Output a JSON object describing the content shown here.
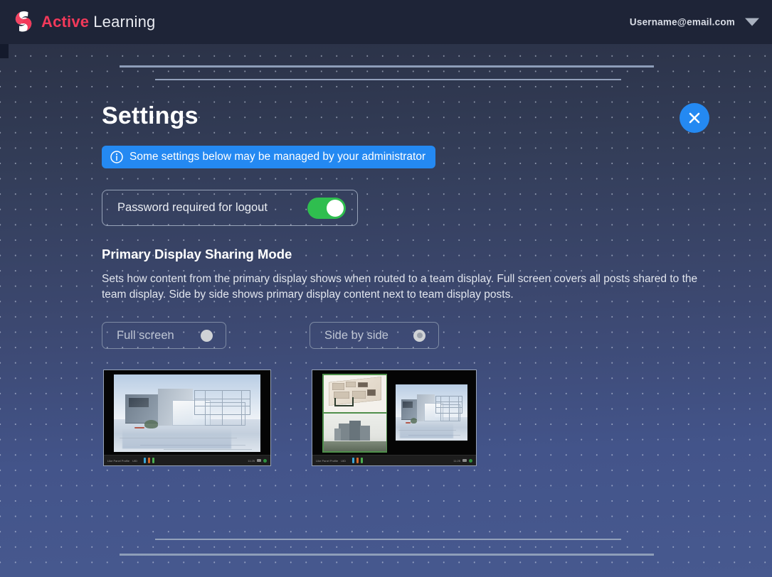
{
  "header": {
    "logo_icon": "spiral-s-logo-icon",
    "brand_primary": "Active",
    "brand_secondary": "Learning",
    "account_email": "Username@email.com",
    "account_caret_icon": "chevron-down-icon",
    "colors": {
      "bar": "#1e2437",
      "brand_accent": "#f2395a"
    }
  },
  "modal": {
    "title": "Settings",
    "close_icon": "close-x-icon",
    "close_color": "#2489f2",
    "banner": {
      "icon": "info-circle-icon",
      "text": "Some settings below may be managed by your administrator",
      "color": "#2489f2"
    },
    "password_setting": {
      "label": "Password required for logout",
      "toggle_state": "on",
      "toggle_color": "#2fbe4f"
    },
    "sharing": {
      "heading": "Primary Display Sharing Mode",
      "description": "Sets how content from the primary display shows when routed to a team display. Full screen covers all posts shared to the team display. Side by side shows primary display content next to team display posts.",
      "options": [
        {
          "label": "Full screen",
          "selected": false,
          "preview_name": "full-screen-preview"
        },
        {
          "label": "Side by side",
          "selected": true,
          "preview_name": "side-by-side-preview"
        }
      ]
    }
  },
  "previews": {
    "status_bar_left": "Like Panel Profile",
    "status_bar_id": "UID",
    "status_bar_time": "11:25",
    "full_screen": {
      "alt": "display showing one full-screen architectural render post"
    },
    "side_by_side": {
      "alt": "display showing two shared posts on the left and primary display render on the right"
    }
  },
  "background": {
    "gradient_top": "#2b3247",
    "gradient_bottom": "#47598f",
    "dot_color": "#d6deee"
  }
}
